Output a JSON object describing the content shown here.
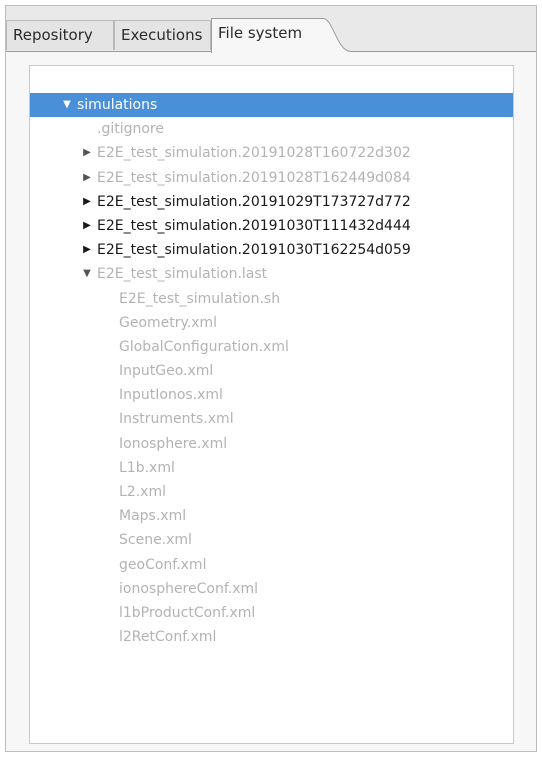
{
  "tabs": [
    {
      "label": "Repository",
      "active": false
    },
    {
      "label": "Executions",
      "active": false
    },
    {
      "label": "File system",
      "active": true
    }
  ],
  "colors": {
    "selection": "#4a90d9",
    "text_dark": "#1a1a1a",
    "text_faded": "#b3b3b3",
    "panel_bg": "#f7f7f7"
  },
  "tree": {
    "root": {
      "label": "simulations",
      "expanded": true,
      "selected": true,
      "twisty_icon": "chevron-down-icon"
    },
    "children": [
      {
        "label": ".gitignore",
        "type": "file",
        "faded": true
      },
      {
        "label": "E2E_test_simulation.20191028T160722d302",
        "type": "folder",
        "expanded": false,
        "faded": true,
        "twisty_icon": "chevron-right-icon"
      },
      {
        "label": "E2E_test_simulation.20191028T162449d084",
        "type": "folder",
        "expanded": false,
        "faded": true,
        "twisty_icon": "chevron-right-icon"
      },
      {
        "label": "E2E_test_simulation.20191029T173727d772",
        "type": "folder",
        "expanded": false,
        "faded": false,
        "twisty_icon": "chevron-right-icon"
      },
      {
        "label": "E2E_test_simulation.20191030T111432d444",
        "type": "folder",
        "expanded": false,
        "faded": false,
        "twisty_icon": "chevron-right-icon"
      },
      {
        "label": "E2E_test_simulation.20191030T162254d059",
        "type": "folder",
        "expanded": false,
        "faded": false,
        "twisty_icon": "chevron-right-icon"
      },
      {
        "label": "E2E_test_simulation.last",
        "type": "folder",
        "expanded": true,
        "faded": true,
        "twisty_icon": "chevron-down-icon",
        "children": [
          {
            "label": "E2E_test_simulation.sh"
          },
          {
            "label": "Geometry.xml"
          },
          {
            "label": "GlobalConfiguration.xml"
          },
          {
            "label": "InputGeo.xml"
          },
          {
            "label": "InputIonos.xml"
          },
          {
            "label": "Instruments.xml"
          },
          {
            "label": "Ionosphere.xml"
          },
          {
            "label": "L1b.xml"
          },
          {
            "label": "L2.xml"
          },
          {
            "label": "Maps.xml"
          },
          {
            "label": "Scene.xml"
          },
          {
            "label": "geoConf.xml"
          },
          {
            "label": "ionosphereConf.xml"
          },
          {
            "label": "l1bProductConf.xml"
          },
          {
            "label": "l2RetConf.xml"
          }
        ]
      }
    ]
  }
}
